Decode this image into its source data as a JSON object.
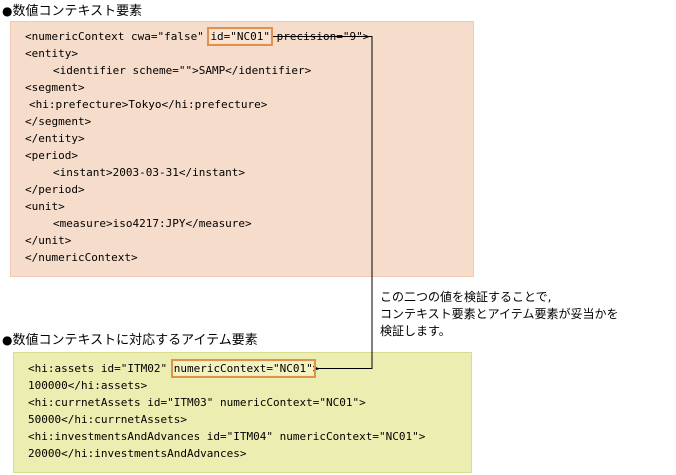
{
  "heading_context": "数値コンテキスト要素",
  "heading_item": "数値コンテキストに対応するアイテム要素",
  "bullet": "●",
  "context_code": {
    "l1_pre": "<numericContext cwa=\"false\" ",
    "l1_hl": "id=\"NC01\"",
    "l1_post": " precision=\"9\">",
    "l2": "<entity>",
    "l3": "<identifier scheme=\"\">SAMP</identifier>",
    "l4": "<segment>",
    "l5": "<hi:prefecture>Tokyo</hi:prefecture>",
    "l6": "</segment>",
    "l7": "</entity>",
    "l8": "<period>",
    "l9": "<instant>2003-03-31</instant>",
    "l10": "</period>",
    "l11": "<unit>",
    "l12": "<measure>iso4217:JPY</measure>",
    "l13": "</unit>",
    "l14": "</numericContext>"
  },
  "item_code": {
    "l1_pre": "<hi:assets id=\"ITM02\" ",
    "l1_hl": "numericContext=\"NC01\"",
    "l1_post": ">",
    "l2": "100000</hi:assets>",
    "l3": "<hi:currnetAssets id=\"ITM03\" numericContext=\"NC01\">",
    "l4": "50000</hi:currnetAssets>",
    "l5": "<hi:investmentsAndAdvances id=\"ITM04\" numericContext=\"NC01\">",
    "l6": "20000</hi:investmentsAndAdvances>"
  },
  "note": {
    "line1": "この二つの値を検証することで,",
    "line2": "コンテキスト要素とアイテム要素が妥当かを",
    "line3": "検証します。"
  },
  "colors": {
    "context_bg": "#f6dccb",
    "item_bg": "#ecedb0",
    "highlight": "#e0914b",
    "connector": "#000000"
  }
}
